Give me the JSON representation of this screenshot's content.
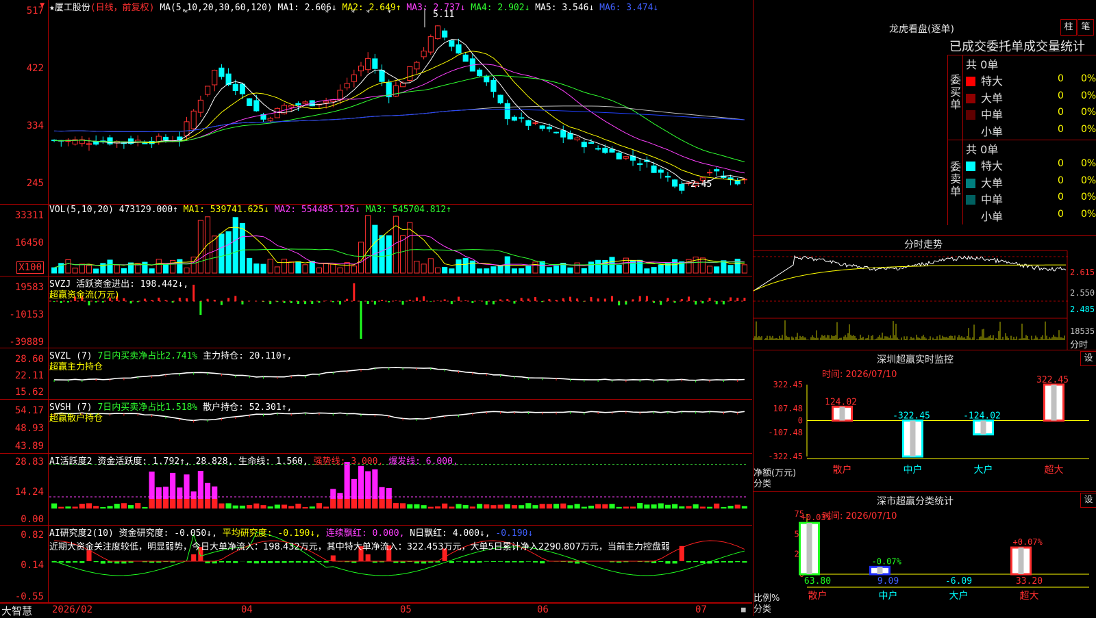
{
  "stock": {
    "star": "★",
    "name": "厦工股份",
    "mode": "(日线，前复权)"
  },
  "main": {
    "ma_label": "MA(5,10,20,30,60,120)",
    "ma1": "MA1: 2.606↓",
    "ma2": "MA2: 2.649↑",
    "ma3": "MA3: 2.737↓",
    "ma4": "MA4: 2.902↓",
    "ma5": "MA5: 3.546↓",
    "ma6": "MA6: 3.474↓",
    "high_label": "5.11",
    "low_label": "2.45",
    "yticks": [
      "517",
      "422",
      "334",
      "245"
    ]
  },
  "vol": {
    "label": "VOL(5,10,20)",
    "value": "473129.000↑",
    "ma1": "MA1: 539741.625↓",
    "ma2": "MA2: 554485.125↓",
    "ma3": "MA3: 545704.812↑",
    "yticks": [
      "33311",
      "16450",
      "X100"
    ]
  },
  "svzj": {
    "label": "SVZJ",
    "desc": "活跃资金进出: 198.442↓,",
    "sub": "超赢资金流(万元)",
    "yticks": [
      "19583",
      "-10153",
      "-39889"
    ]
  },
  "svzl": {
    "label": "SVZL (7)",
    "desc": "7日内买卖净占比2.741%",
    "hold": "主力持仓: 20.110↑,",
    "sub": "超赢主力持仓",
    "yticks": [
      "28.60",
      "22.11",
      "15.62"
    ]
  },
  "svsh": {
    "label": "SVSH (7)",
    "desc": "7日内买卖净占比1.518%",
    "hold": "散户持仓: 52.301↑,",
    "sub": "超赢散户持仓",
    "yticks": [
      "54.17",
      "48.93",
      "43.89"
    ]
  },
  "ai2": {
    "label": "AI活跃度2",
    "a": "资金活跃度: 1.792↑,",
    "b": "28.828,",
    "c": "生命线: 1.560,",
    "d": "强势线: 3.000,",
    "e": "爆发线: 6.000,",
    "yticks": [
      "28.83",
      "14.24",
      "0.00"
    ]
  },
  "ai3": {
    "label": "AI研究度2(10)",
    "a": "资金研究度: -0.050↓,",
    "b": "平均研究度: -0.190↓,",
    "c": "连续飘红: 0.000,",
    "d": "N日飘红: 4.000↓,",
    "e": "-0.190↓",
    "text": "近期大资金关注度较低，明显弱势，今日大单净流入：198.432万元，其中特大单净流入：322.453万元，大单5日累计净入2290.807万元，当前主力控盘弱",
    "yticks": [
      "0.82",
      "0.14",
      "-0.55"
    ]
  },
  "xaxis": {
    "brand": "大智慧",
    "labels": [
      "2026/02",
      "04",
      "05",
      "06",
      "07"
    ]
  },
  "dragon": {
    "title": "龙虎看盘(逐单)",
    "btn1": "柱",
    "btn2": "笔",
    "subtitle": "已成交委托单成交量统计",
    "buy": {
      "label": "委买单",
      "total": "共 0单",
      "rows": [
        {
          "name": "特大",
          "val": "0",
          "pct": "0%",
          "color": "#ff0000"
        },
        {
          "name": "大单",
          "val": "0",
          "pct": "0%",
          "color": "#900000"
        },
        {
          "name": "中单",
          "val": "0",
          "pct": "0%",
          "color": "#600000"
        },
        {
          "name": "小单",
          "val": "0",
          "pct": "0%",
          "color": "#000000"
        }
      ]
    },
    "sell": {
      "label": "委卖单",
      "total": "共 0单",
      "rows": [
        {
          "name": "特大",
          "val": "0",
          "pct": "0%",
          "color": "#00ffff"
        },
        {
          "name": "大单",
          "val": "0",
          "pct": "0%",
          "color": "#008080"
        },
        {
          "name": "中单",
          "val": "0",
          "pct": "0%",
          "color": "#006060"
        },
        {
          "name": "小单",
          "val": "0",
          "pct": "0%",
          "color": "#000000"
        }
      ]
    }
  },
  "intraday": {
    "title": "分时走势",
    "yticks": [
      "2.615",
      "2.550",
      "2.485",
      "18535",
      "分时"
    ]
  },
  "monitor": {
    "title": "深圳超赢实时监控",
    "btn": "设",
    "time": "时间: 2026/07/10",
    "yticks": [
      "322.45",
      "107.48",
      "0",
      "-107.48",
      "-322.45"
    ],
    "ylabel": "净额(万元)",
    "xlabel": "分类",
    "chart_data": {
      "type": "bar",
      "categories": [
        "散户",
        "中户",
        "大户",
        "超大"
      ],
      "values": [
        124.02,
        -322.45,
        -124.02,
        322.45
      ],
      "value_labels": [
        "124.02",
        "-322.45",
        "-124.02",
        "322.45"
      ],
      "ylim": [
        -322.45,
        322.45
      ]
    }
  },
  "classify": {
    "title": "深市超赢分类统计",
    "btn": "设",
    "time": "时间: 2026/07/10",
    "yticks": [
      "75",
      "50",
      "25",
      "0"
    ],
    "ylabel": "比例%",
    "xlabel": "分类",
    "chart_data": {
      "type": "bar",
      "categories": [
        "散户",
        "中户",
        "大户",
        "超大"
      ],
      "values": [
        63.8,
        9.09,
        -6.09,
        33.2
      ],
      "pct_labels": [
        "+0.03%",
        "-0.07%",
        "",
        "+0.07%"
      ],
      "value_labels": [
        "63.80",
        "9.09",
        "-6.09",
        "33.20"
      ],
      "ylim": [
        0,
        75
      ]
    }
  }
}
